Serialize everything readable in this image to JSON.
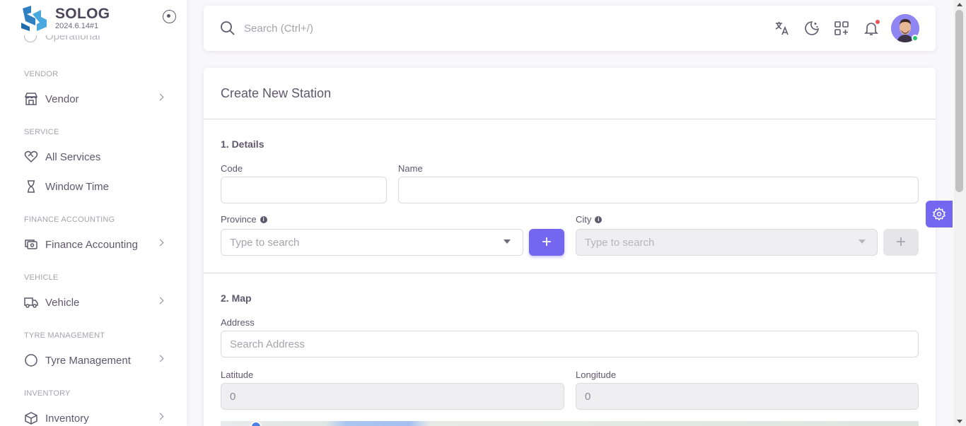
{
  "brand": {
    "name": "SOLOG",
    "version": "2024.6.14#1"
  },
  "sidebar": {
    "clipped_item": "Operational",
    "sections": [
      {
        "label": "VENDOR",
        "items": [
          {
            "label": "Vendor",
            "icon": "store-icon",
            "has_children": true
          }
        ]
      },
      {
        "label": "SERVICE",
        "items": [
          {
            "label": "All Services",
            "icon": "heart-handshake-icon",
            "has_children": false
          },
          {
            "label": "Window Time",
            "icon": "hourglass-icon",
            "has_children": false
          }
        ]
      },
      {
        "label": "FINANCE ACCOUNTING",
        "items": [
          {
            "label": "Finance Accounting",
            "icon": "cash-icon",
            "has_children": true
          }
        ]
      },
      {
        "label": "VEHICLE",
        "items": [
          {
            "label": "Vehicle",
            "icon": "truck-icon",
            "has_children": true
          }
        ]
      },
      {
        "label": "TYRE MANAGEMENT",
        "items": [
          {
            "label": "Tyre Management",
            "icon": "circle-icon",
            "has_children": true
          }
        ]
      },
      {
        "label": "INVENTORY",
        "items": [
          {
            "label": "Inventory",
            "icon": "box-icon",
            "has_children": true
          }
        ]
      }
    ]
  },
  "topbar": {
    "search_placeholder": "Search (Ctrl+/)",
    "icons": [
      "translate-icon",
      "moon-icon",
      "apps-add-icon",
      "bell-icon"
    ],
    "notification_dot_color": "#ea5455",
    "online_status_color": "#28c76f"
  },
  "form": {
    "title": "Create New Station",
    "details": {
      "heading": "1. Details",
      "code_label": "Code",
      "code_value": "",
      "name_label": "Name",
      "name_value": "",
      "province_label": "Province",
      "province_placeholder": "Type to search",
      "city_label": "City",
      "city_placeholder": "Type to search"
    },
    "map": {
      "heading": "2. Map",
      "address_label": "Address",
      "address_placeholder": "Search Address",
      "latitude_label": "Latitude",
      "latitude_value": "0",
      "longitude_label": "Longitude",
      "longitude_value": "0"
    }
  },
  "colors": {
    "primary": "#7367f0",
    "text": "#5d586c",
    "muted": "#a5a3ae",
    "border": "#dbdade"
  }
}
